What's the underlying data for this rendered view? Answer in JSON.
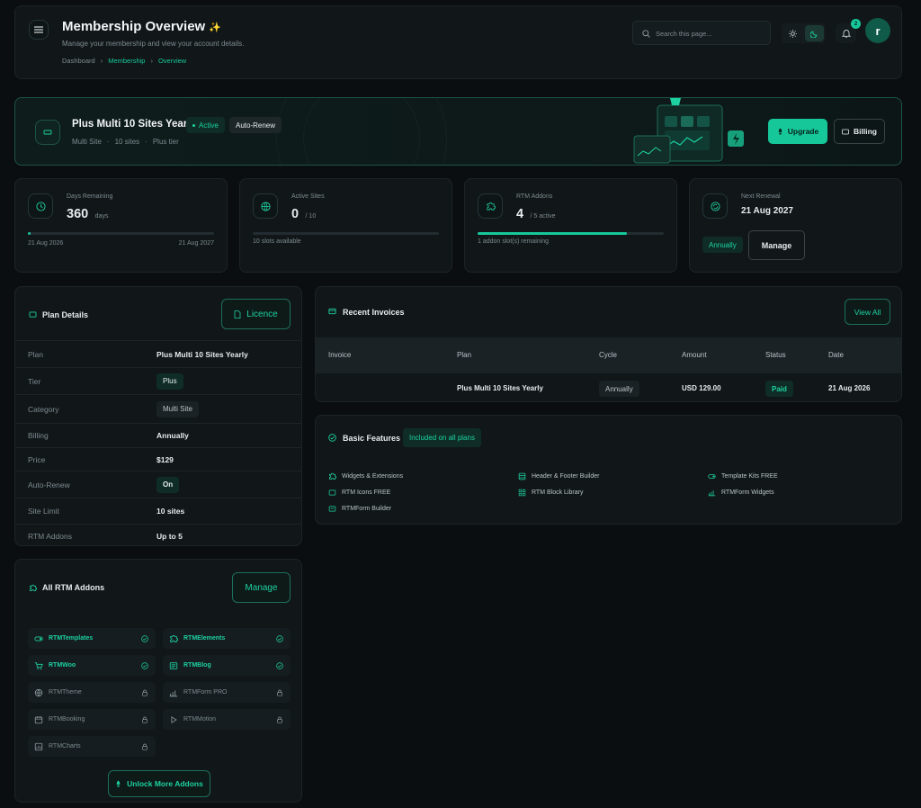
{
  "header": {
    "title": "Membership Overview",
    "sparkle": "✨",
    "subtitle": "Manage your membership and view your account details.",
    "breadcrumb": [
      "Dashboard",
      "Membership",
      "Overview"
    ],
    "search_placeholder": "Search this page...",
    "notification_count": "2",
    "avatar_letter": "r"
  },
  "plan_banner": {
    "name": "Plus Multi 10 Sites Yearly",
    "status": "Active",
    "renew": "Auto-Renew",
    "meta": [
      "Multi Site",
      "10 sites",
      "Plus tier"
    ],
    "upgrade_label": "Upgrade",
    "billing_label": "Billing"
  },
  "stats": {
    "days": {
      "label": "Days Remaining",
      "value": "360",
      "unit": "days",
      "start": "21 Aug 2026",
      "end": "21 Aug 2027",
      "progress": 0.014
    },
    "sites": {
      "label": "Active Sites",
      "value": "0",
      "unit": "/ 10",
      "note": "10 slots available",
      "progress": 0
    },
    "addons": {
      "label": "RTM Addons",
      "value": "4",
      "unit": "/ 5 active",
      "note": "1 addon slot(s) remaining",
      "progress": 0.8
    },
    "renewal": {
      "label": "Next Renewal",
      "value": "21 Aug 2027",
      "cycle": "Annually",
      "manage_label": "Manage"
    }
  },
  "plan_details": {
    "title": "Plan Details",
    "licence_label": "Licence",
    "rows": [
      {
        "key": "Plan",
        "value": "Plus Multi 10 Sites Yearly"
      },
      {
        "key": "Tier",
        "value": "Plus"
      },
      {
        "key": "Category",
        "value": "Multi Site"
      },
      {
        "key": "Billing",
        "value": "Annually"
      },
      {
        "key": "Price",
        "value": "$129"
      },
      {
        "key": "Auto-Renew",
        "value": "On"
      },
      {
        "key": "Site Limit",
        "value": "10 sites"
      },
      {
        "key": "RTM Addons",
        "value": "Up to 5"
      }
    ]
  },
  "addons": {
    "title": "All RTM Addons",
    "manage_label": "Manage",
    "unlock_label": "Unlock More Addons",
    "items": [
      {
        "name": "RTMTemplates",
        "active": true,
        "icon": "toggle-icon"
      },
      {
        "name": "RTMElements",
        "active": true,
        "icon": "puzzle-icon"
      },
      {
        "name": "RTMWoo",
        "active": true,
        "icon": "cart-icon"
      },
      {
        "name": "RTMBlog",
        "active": true,
        "icon": "newspaper-icon"
      },
      {
        "name": "RTMTheme",
        "active": false,
        "icon": "globe-icon"
      },
      {
        "name": "RTMForm PRO",
        "active": false,
        "icon": "bar-chart-icon"
      },
      {
        "name": "RTMBooking",
        "active": false,
        "icon": "calendar-icon"
      },
      {
        "name": "RTMMotion",
        "active": false,
        "icon": "play-icon"
      },
      {
        "name": "RTMCharts",
        "active": false,
        "icon": "chart-icon"
      }
    ]
  },
  "invoices": {
    "title": "Recent Invoices",
    "view_all_label": "View All",
    "columns": [
      "Invoice",
      "Plan",
      "Cycle",
      "Amount",
      "Status",
      "Date"
    ],
    "rows": [
      {
        "invoice": "",
        "plan": "Plus Multi 10 Sites Yearly",
        "cycle": "Annually",
        "amount": "USD 129.00",
        "status": "Paid",
        "date": "21 Aug 2026"
      }
    ]
  },
  "features": {
    "title": "Basic Features",
    "badge": "Included on all plans",
    "items": [
      "Widgets & Extensions",
      "Header & Footer Builder",
      "Template Kits FREE",
      "RTM Icons FREE",
      "RTM Block Library",
      "RTMForm Widgets",
      "RTMForm Builder"
    ]
  },
  "colors": {
    "accent": "#16c79a",
    "background": "#0a0e11",
    "card": "#111719"
  }
}
